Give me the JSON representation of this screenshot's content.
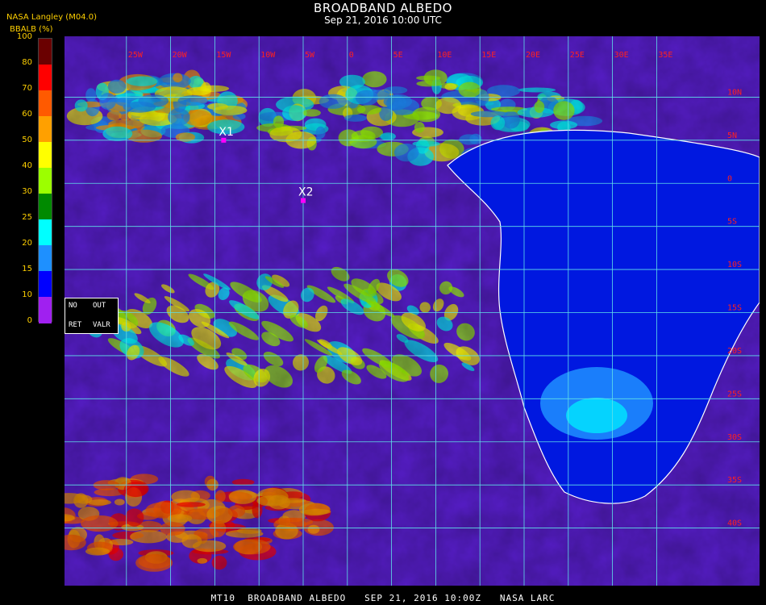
{
  "header": {
    "title": "BROADBAND ALBEDO",
    "datetime": "Sep 21, 2016 10:00 UTC",
    "provider": "NASA Langley (M04.0)"
  },
  "colorbar": {
    "label": "BBALB (%)",
    "ticks": [
      "100",
      "80",
      "70",
      "60",
      "50",
      "40",
      "30",
      "25",
      "20",
      "15",
      "10",
      "0"
    ],
    "colors": [
      "#6a0000",
      "#ff0000",
      "#ff5a00",
      "#ffa000",
      "#ffff00",
      "#9cff00",
      "#008a00",
      "#00ffff",
      "#1e90ff",
      "#0000ff",
      "#a020f0"
    ]
  },
  "legend": {
    "no": "NO",
    "out": "OUT",
    "ret": "RET",
    "valr": "VALR"
  },
  "markers": [
    {
      "label": "X1",
      "lat": 5,
      "lon": -14
    },
    {
      "label": "X2",
      "lat": -2,
      "lon": -5
    }
  ],
  "map": {
    "lat_range": [
      -45,
      15
    ],
    "lon_range": [
      -30,
      45
    ],
    "grid_lon_labels": [
      "25W",
      "20W",
      "15W",
      "10W",
      "5W",
      "0",
      "5E",
      "10E",
      "15E",
      "20E",
      "25E",
      "30E",
      "35E"
    ],
    "grid_lat_labels": [
      "10N",
      "5N",
      "0",
      "5S",
      "10S",
      "15S",
      "20S",
      "25S",
      "30S",
      "35S",
      "40S"
    ]
  },
  "footer": "MT10  BROADBAND ALBEDO   SEP 21, 2016 10:00Z   NASA LARC"
}
